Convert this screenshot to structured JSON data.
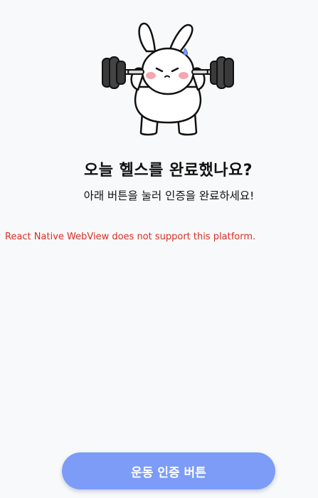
{
  "illustration": {
    "icon": "bunny-lifting-barbell-icon"
  },
  "header": {
    "title": "오늘 헬스를 완료했나요?",
    "subtitle": "아래 버튼을 눌러 인증을 완료하세요!"
  },
  "webview": {
    "error_message": "React Native WebView does not support this platform."
  },
  "actions": {
    "verify_label": "운동 인증 버튼"
  },
  "colors": {
    "background": "#f8f9fa",
    "button": "#7c9cf7",
    "error_text": "#d93025"
  }
}
